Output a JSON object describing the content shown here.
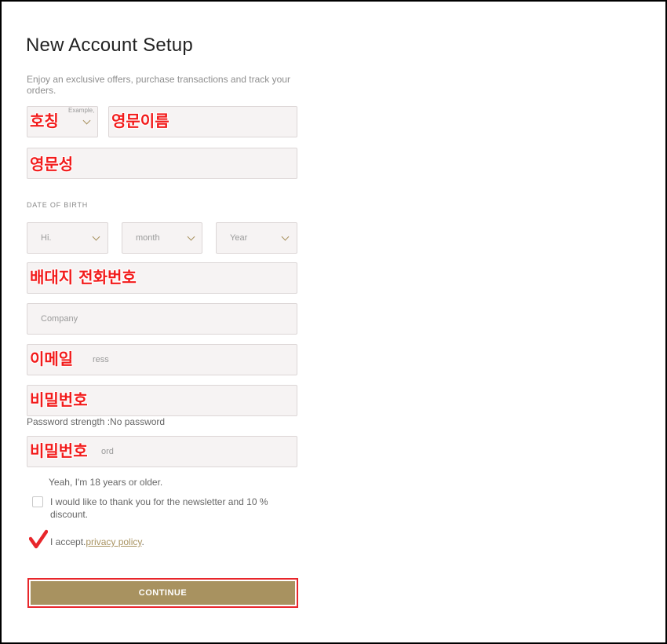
{
  "header": {
    "title": "New Account Setup",
    "subtitle": "Enjoy an exclusive offers, purchase transactions and track your orders."
  },
  "form": {
    "title_select": {
      "placeholder": "Example,",
      "overlay": "호칭"
    },
    "first_name": {
      "placeholder": "",
      "overlay": "영문이름"
    },
    "last_name": {
      "placeholder": "",
      "overlay": "영문성"
    },
    "dob_label": "DATE OF BIRTH",
    "day_select": "Hi.",
    "month_select": "month",
    "year_select": "Year",
    "phone": {
      "placeholder": "",
      "overlay": "배대지 전화번호"
    },
    "company": {
      "placeholder": "Company"
    },
    "email": {
      "placeholder": "ress",
      "overlay": "이메일"
    },
    "password": {
      "placeholder": "",
      "overlay": "비밀번호"
    },
    "password_strength": "Password strength :No password",
    "confirm_password": {
      "placeholder": "ord",
      "overlay": "비밀번호"
    },
    "age_confirm": "Yeah, I'm 18 years or older.",
    "newsletter": {
      "label": "I would like to thank you for the newsletter and 10 % discount.",
      "checked": false
    },
    "privacy": {
      "label": "I accept.",
      "link": "privacy policy",
      "after": ".",
      "checked": true
    }
  },
  "actions": {
    "continue_label": "CONTINUE"
  },
  "colors": {
    "accent": "#a89260",
    "field_bg": "#f6f3f3",
    "annotation_red": "#f21b1b"
  }
}
